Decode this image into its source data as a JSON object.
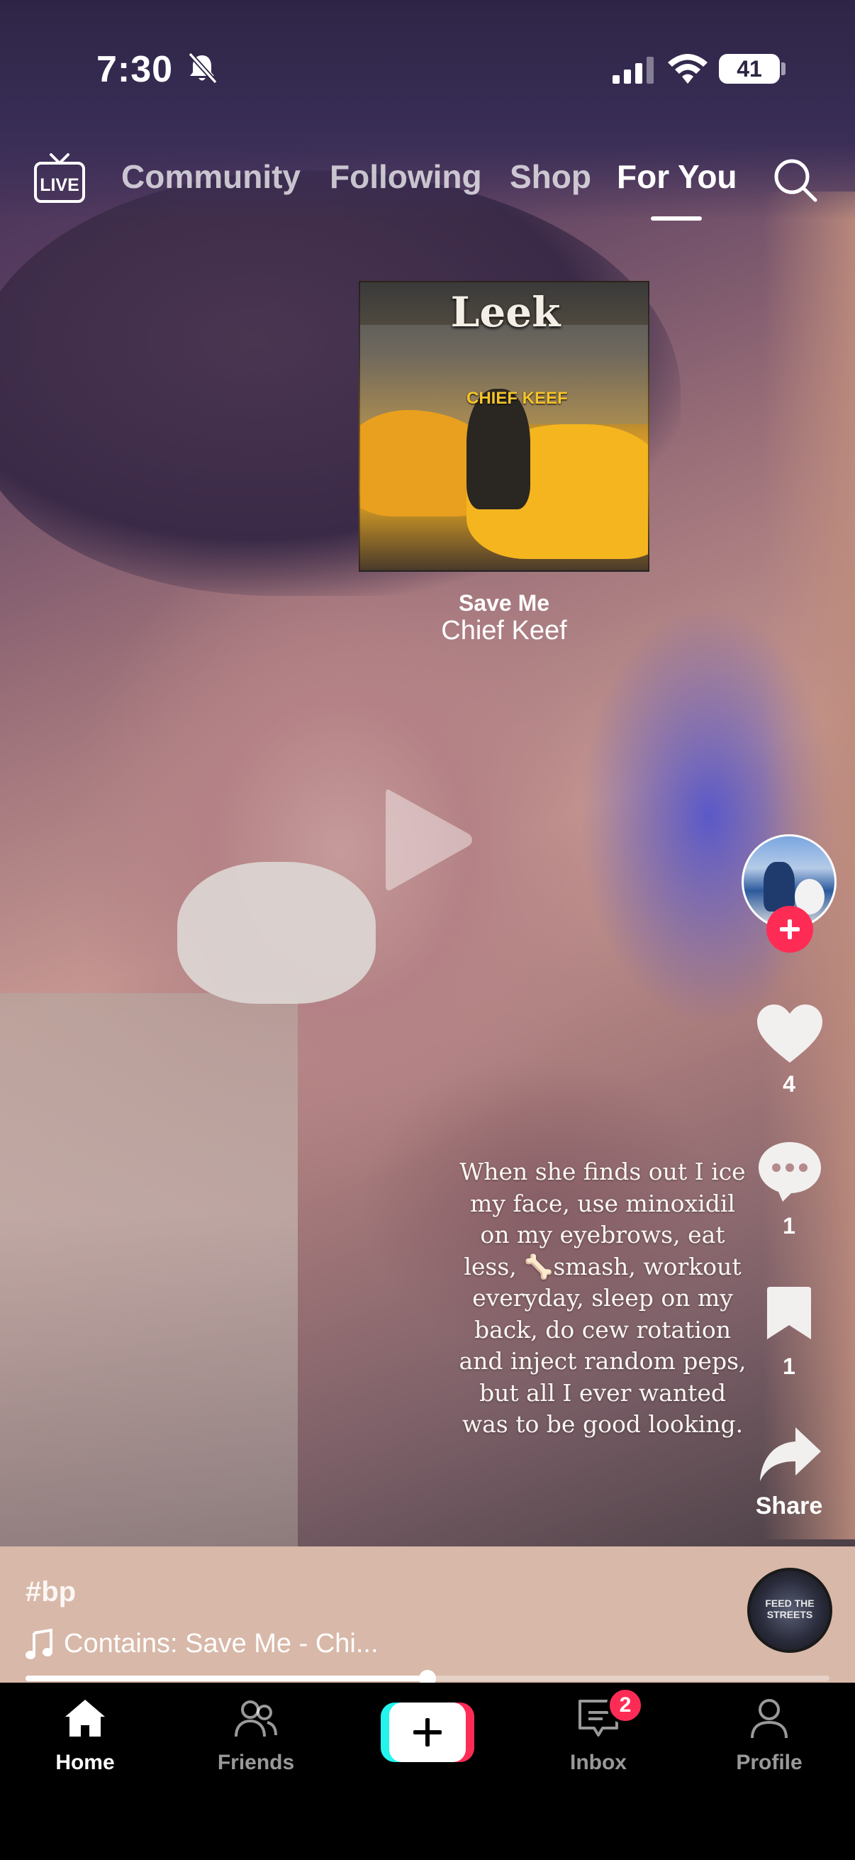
{
  "status_bar": {
    "time": "7:30",
    "battery": "41"
  },
  "top_nav": {
    "live_label": "LIVE",
    "tabs": [
      {
        "label": "Community",
        "active": false
      },
      {
        "label": "Following",
        "active": false
      },
      {
        "label": "Shop",
        "active": false
      },
      {
        "label": "For You",
        "active": true
      }
    ]
  },
  "album_sticker": {
    "cover_title": "Leek",
    "cover_artist": "CHIEF KEEF",
    "song_title": "Save Me",
    "artist": "Chief Keef"
  },
  "caption": "When she finds out I ice\nmy face, use minoxidil\non my eyebrows, eat\nless, 🦴smash, workout\neveryday, sleep on my\nback, do cew rotation\nand inject random peps,\nbut all I ever wanted\nwas to be good looking.",
  "actions": {
    "likes": "4",
    "comments": "1",
    "saves": "1",
    "share_label": "Share"
  },
  "video_info": {
    "hashtag": "#bp",
    "music": "Contains: Save Me - Chi...",
    "disc_label": "FEED THE STREETS",
    "progress": 0.5
  },
  "tab_bar": {
    "items": [
      {
        "label": "Home",
        "active": true
      },
      {
        "label": "Friends",
        "active": false
      },
      {
        "label": "Inbox",
        "active": false
      },
      {
        "label": "Profile",
        "active": false
      }
    ],
    "inbox_badge": "2"
  },
  "colors": {
    "accent_red": "#fe2c55",
    "accent_cyan": "#25f4ee",
    "status_bg": "#2e2546"
  }
}
